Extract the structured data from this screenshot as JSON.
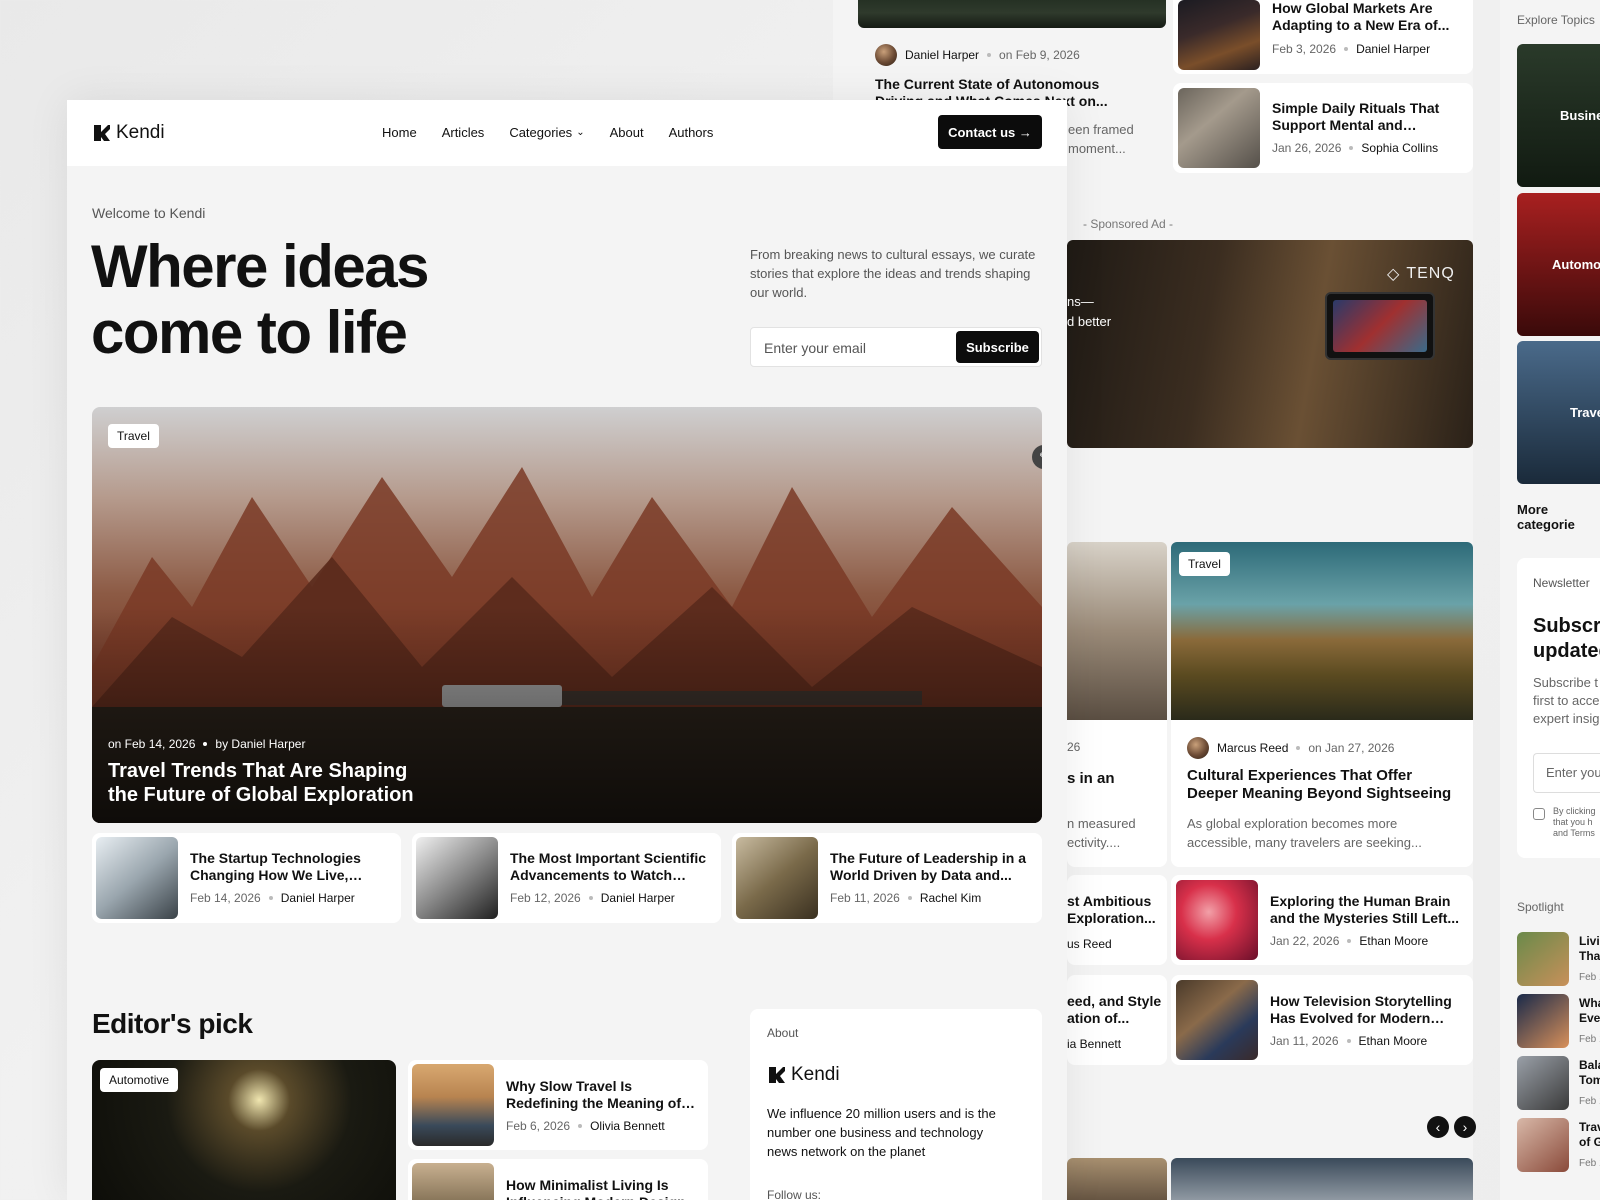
{
  "back_page": {
    "top_article": {
      "author": "Daniel Harper",
      "date": "on Feb 9, 2026",
      "title": "The Current State of Autonomous Driving and What Comes Next on...",
      "excerpt_fragment": "een framed moment..."
    },
    "right_list": [
      {
        "title": "How Global Markets Are Adapting to a New Era of...",
        "date": "Feb 3, 2026",
        "author": "Daniel Harper"
      },
      {
        "title": "Simple Daily Rituals That Support Mental and Physical...",
        "date": "Jan 26, 2026",
        "author": "Sophia Collins"
      }
    ],
    "sponsored_label": "- Sponsored Ad -",
    "ad": {
      "brand": "TENQ",
      "text_fragment_1": "ns—",
      "text_fragment_2": "d better"
    },
    "featured_card": {
      "badge": "Travel",
      "author": "Marcus Reed",
      "date": "on Jan 27, 2026",
      "title": "Cultural Experiences That Offer Deeper Meaning Beyond Sightseeing",
      "excerpt": "As global exploration becomes more accessible, many travelers are seeking..."
    },
    "left_partial": {
      "date_fragment": "26",
      "title_fragment": "s in an",
      "excerpt_fragment_1": "n measured",
      "excerpt_fragment_2": "ectivity...."
    },
    "left_list_partial": [
      {
        "title_1": "st Ambitious",
        "title_2": "Exploration...",
        "author": "us Reed"
      },
      {
        "title_1": "eed, and Style",
        "title_2": "ation of...",
        "author": "ia Bennett"
      }
    ],
    "list_items": [
      {
        "title": "Exploring the Human Brain and the Mysteries Still Left...",
        "date": "Jan 22, 2026",
        "author": "Ethan Moore"
      },
      {
        "title": "How Television Storytelling Has Evolved for Modern Audiences",
        "date": "Jan 11, 2026",
        "author": "Ethan Moore"
      }
    ],
    "carousel": {
      "prev": "‹",
      "next": "›"
    }
  },
  "sidebar": {
    "explore_title": "Explore Topics",
    "topics": [
      "Busine",
      "Automo",
      "Trave"
    ],
    "more_categories": "More categorie",
    "newsletter": {
      "label": "Newsletter",
      "title_1": "Subscri",
      "title_2": "updated",
      "desc_1": "Subscribe t",
      "desc_2": "first to acce",
      "desc_3": "expert insig",
      "input_placeholder": "Enter you",
      "consent_1": "By clicking",
      "consent_2": "that you h",
      "consent_3": "and Terms"
    },
    "spotlight_title": "Spotlight",
    "spotlight": [
      {
        "t1": "Livin",
        "t2": "That",
        "d": "Feb 1"
      },
      {
        "t1": "What",
        "t2": "Ever",
        "d": "Feb 1"
      },
      {
        "t1": "Bala",
        "t2": "Tom",
        "d": "Feb 1"
      },
      {
        "t1": "Trav",
        "t2": "of G",
        "d": "Feb 1"
      }
    ]
  },
  "nav": {
    "logo": "Kendi",
    "links": [
      "Home",
      "Articles",
      "Categories",
      "About",
      "Authors"
    ],
    "cta": "Contact us →"
  },
  "hero": {
    "welcome": "Welcome to Kendi",
    "headline_1": "Where ideas",
    "headline_2": "come to life",
    "description": "From breaking news to cultural essays, we curate stories that explore the ideas and trends shaping our world.",
    "email_placeholder": "Enter your email",
    "subscribe": "Subscribe"
  },
  "featured": {
    "badge": "Travel",
    "date": "on Feb 14, 2026",
    "by": "by Daniel Harper",
    "title": "Travel Trends That Are Shaping the Future of Global Exploration"
  },
  "mini_articles": [
    {
      "title": "The Startup Technologies Changing How We Live, Work,...",
      "date": "Feb 14, 2026",
      "author": "Daniel Harper"
    },
    {
      "title": "The Most Important Scientific Advancements to Watch This...",
      "date": "Feb 12, 2026",
      "author": "Daniel Harper"
    },
    {
      "title": "The Future of Leadership in a World Driven by Data and...",
      "date": "Feb 11, 2026",
      "author": "Rachel Kim"
    }
  ],
  "editors_pick": {
    "title": "Editor's pick",
    "main_badge": "Automotive",
    "items": [
      {
        "title": "Why Slow Travel Is Redefining the Meaning of Modern...",
        "date": "Feb 6, 2026",
        "author": "Olivia Bennett"
      },
      {
        "title": "How Minimalist Living Is Influencing Modern Design an...",
        "date": "",
        "author": ""
      }
    ]
  },
  "about": {
    "label": "About",
    "logo": "Kendi",
    "text": "We influence 20 million users and is the number one business and technology news network on the planet",
    "follow": "Follow us:"
  }
}
